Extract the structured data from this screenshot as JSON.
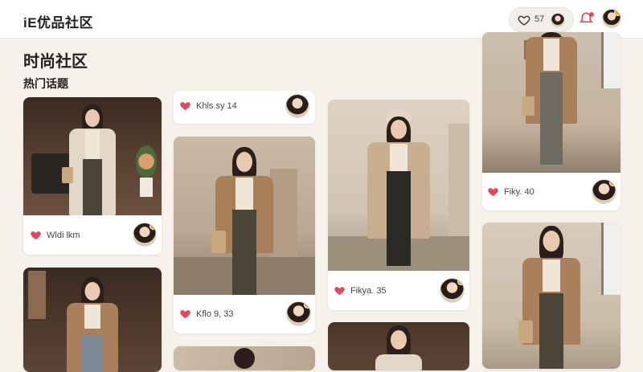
{
  "app": {
    "logo_text": "iE优品社区"
  },
  "topbar": {
    "like_count": "57",
    "icons": [
      "heart-outline-icon",
      "notification-icon",
      "user-avatar"
    ]
  },
  "page": {
    "title": "时尚社区",
    "section": "热门话题"
  },
  "colors": {
    "background": "#f6f1ea",
    "heart": "#e8455f",
    "badge": "#f5a623",
    "alert": "#e8455f"
  },
  "cards": [
    {
      "id": "card-1",
      "meta": "Wldi lkm"
    },
    {
      "id": "card-2",
      "meta": "Khls.sy 14"
    },
    {
      "id": "card-3",
      "meta": "Kflo 9, 33"
    },
    {
      "id": "card-4",
      "meta": "Fikya. 35"
    },
    {
      "id": "card-5",
      "meta": "Fiky. 40"
    },
    {
      "id": "card-6",
      "meta": ""
    },
    {
      "id": "card-7",
      "meta": ""
    },
    {
      "id": "card-8",
      "meta": ""
    },
    {
      "id": "card-9",
      "meta": ""
    }
  ]
}
